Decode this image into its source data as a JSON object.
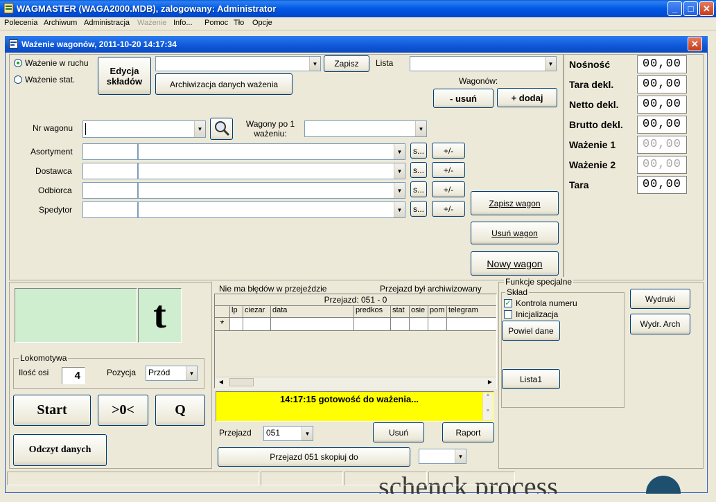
{
  "window": {
    "title": "WAGMASTER (WAGA2000.MDB), zalogowany: Administrator",
    "minimize": "_",
    "maximize": "□",
    "close": "✕"
  },
  "menu": [
    "Polecenia",
    "Archiwum",
    "Administracja",
    "Ważenie",
    "Info...",
    "Pomoc",
    "Tło",
    "Opcje"
  ],
  "child_window": {
    "title": "Ważenie wagonów,  2011-10-20 14:17:34",
    "close": "✕"
  },
  "mode": {
    "option1": "Ważenie w ruchu",
    "option2": "Ważenie stat.",
    "selected": "Ważenie w ruchu"
  },
  "top": {
    "edit_compositions": "Edycja składów",
    "save": "Zapisz",
    "list_label": "Lista",
    "archive_button": "Archiwizacja danych ważenia",
    "wagons_label": "Wagonów:",
    "remove": "- usuń",
    "add": "+ dodaj"
  },
  "wagon": {
    "nr_label": "Nr wagonu",
    "per_weigh_label": "Wagony po 1 ważeniu:"
  },
  "fields": [
    {
      "label": "Asortyment",
      "s": "s...",
      "pm": "+/-"
    },
    {
      "label": "Dostawca",
      "s": "s...",
      "pm": "+/-"
    },
    {
      "label": "Odbiorca",
      "s": "s...",
      "pm": "+/-"
    },
    {
      "label": "Spedytor",
      "s": "s...",
      "pm": "+/-"
    }
  ],
  "wagon_actions": {
    "save": "Zapisz wagon",
    "delete": "Usuń wagon",
    "new": "Nowy wagon"
  },
  "readings": [
    {
      "label": "Nośność",
      "value": "00,00",
      "enabled": true
    },
    {
      "label": "Tara dekl.",
      "value": "00,00",
      "enabled": true
    },
    {
      "label": "Netto dekl.",
      "value": "00,00",
      "enabled": true
    },
    {
      "label": "Brutto dekl.",
      "value": "00,00",
      "enabled": true
    },
    {
      "label": "Ważenie 1",
      "value": "00,00",
      "enabled": false
    },
    {
      "label": "Ważenie 2",
      "value": "00,00",
      "enabled": false
    },
    {
      "label": "Tara",
      "value": "00,00",
      "enabled": true
    }
  ],
  "display": {
    "unit": "t",
    "display_color": "#cfeecf"
  },
  "locomotive": {
    "group": "Lokomotywa",
    "axles_label": "Ilość osi",
    "axles_value": "4",
    "position_label": "Pozycja",
    "position_value": "Przód"
  },
  "controls": {
    "start": "Start",
    "zero": ">0<",
    "q": "Q",
    "read": "Odczyt danych"
  },
  "passage": {
    "errors_status": "Nie ma błędów w przejeździe",
    "archive_status": "Przejazd był archiwizowany",
    "grid_title": "Przejazd: 051 - 0",
    "columns": [
      "",
      "lp",
      "ciezar",
      "data",
      "predkos",
      "stat",
      "osie",
      "pom",
      "telegram"
    ],
    "new_row_marker": "*",
    "message": "14:17:15 gotowość do ważenia...",
    "message_color": "#ffff00",
    "label": "Przejazd",
    "value": "051",
    "delete": "Usuń",
    "report": "Raport",
    "copy_button": "Przejazd 051 skopiuj do"
  },
  "special": {
    "group": "Funkcje specjalne",
    "subgroup": "Skład",
    "check1": "Kontrola numeru",
    "check1_checked": true,
    "check2": "Inicjalizacja",
    "check2_checked": false,
    "repeat": "Powiel dane",
    "list1": "Lista1",
    "prints": "Wydruki",
    "prints_arch": "Wydr. Arch"
  },
  "background_logo": "schenck process"
}
